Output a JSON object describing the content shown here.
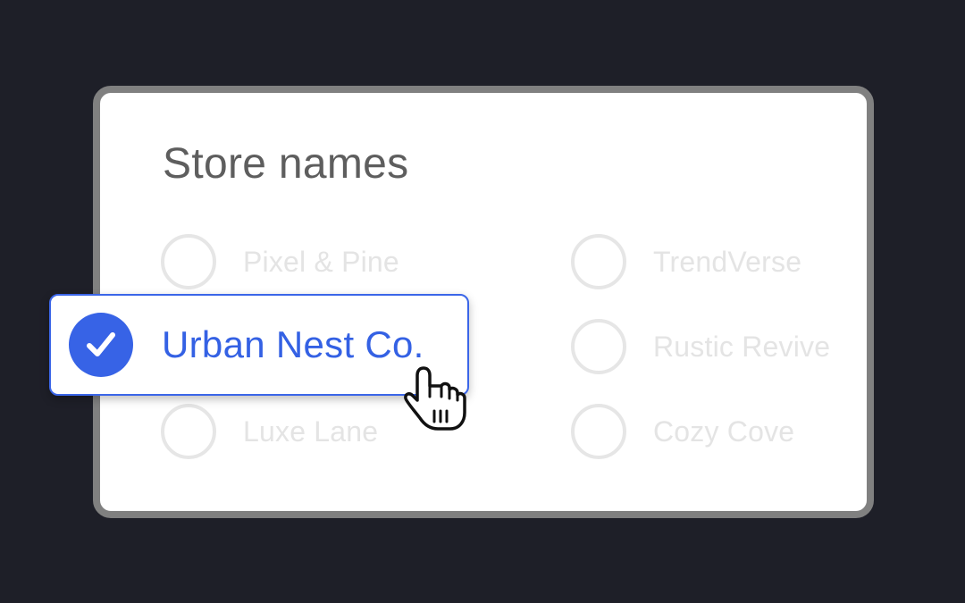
{
  "card": {
    "title": "Store names"
  },
  "options": {
    "pixel_pine": "Pixel & Pine",
    "trendverse": "TrendVerse",
    "urban_nest": "Urban Nest Co.",
    "rustic_revive": "Rustic Revive",
    "luxe_lane": "Luxe Lane",
    "cozy_cove": "Cozy Cove"
  },
  "selected_option": "Urban Nest Co.",
  "colors": {
    "background": "#1e1f28",
    "accent": "#3763e6",
    "card_border": "#808080",
    "muted_text": "#e4e4e4",
    "title_text": "#5e5e5e"
  },
  "icons": {
    "selected_icon": "check-icon",
    "cursor_icon": "hand-pointer-icon"
  }
}
